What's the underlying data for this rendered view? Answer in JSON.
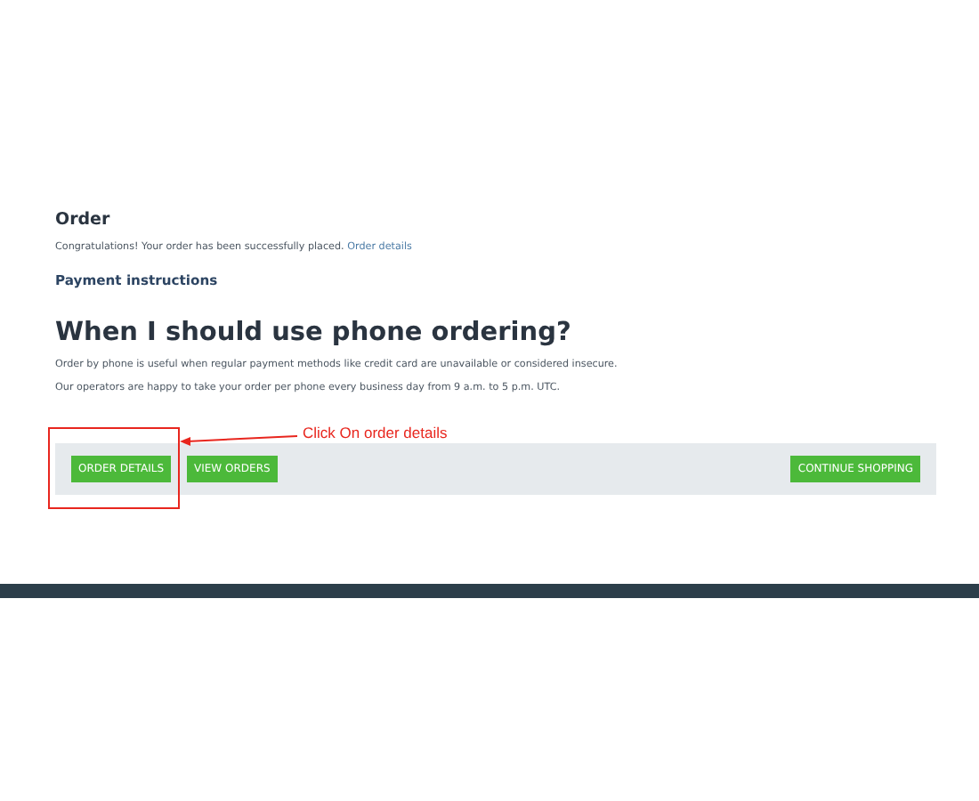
{
  "order": {
    "title": "Order",
    "message": "Congratulations! Your order has been successfully placed.",
    "link": "Order details"
  },
  "payment": {
    "title": "Payment instructions"
  },
  "info": {
    "title": "When I should use phone ordering?",
    "paragraphs": [
      "Order by phone is useful when regular payment methods like credit card are unavailable or considered insecure.",
      "Our operators are happy to take your order per phone every business day from 9 a.m. to 5 p.m. UTC."
    ]
  },
  "actions": {
    "left": [
      "ORDER DETAILS",
      "VIEW ORDERS"
    ],
    "right": [
      "CONTINUE SHOPPING"
    ]
  },
  "annotation": {
    "label": "Click On order details"
  }
}
